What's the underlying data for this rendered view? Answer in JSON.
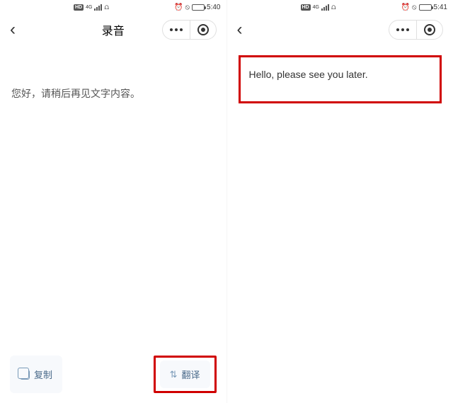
{
  "left": {
    "status": {
      "network_badge": "HD",
      "time": "5:40"
    },
    "nav": {
      "title": "录音"
    },
    "transcript": "您好，请稍后再见文字内容。",
    "actions": {
      "copy": "复制",
      "translate": "翻译"
    }
  },
  "right": {
    "status": {
      "network_badge": "HD",
      "time": "5:41"
    },
    "translation": "Hello, please see you later."
  }
}
